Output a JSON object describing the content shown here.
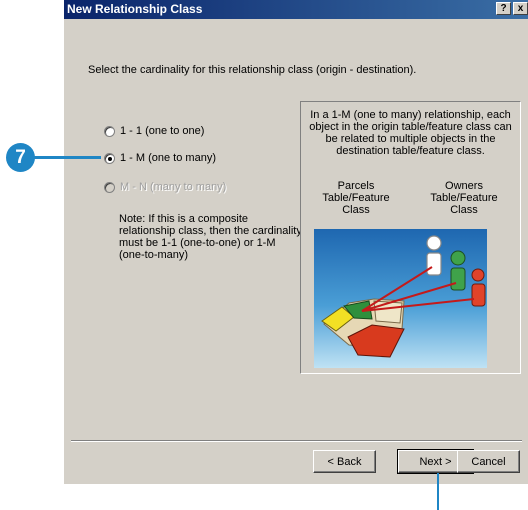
{
  "window": {
    "title": "New Relationship Class",
    "help_glyph": "?",
    "close_glyph": "x"
  },
  "prompt": "Select the cardinality for this relationship class (origin - destination).",
  "options": [
    {
      "label": "1 - 1 (one to one)",
      "checked": false,
      "enabled": true
    },
    {
      "label": "1 - M (one to many)",
      "checked": true,
      "enabled": true
    },
    {
      "label": "M - N (many to many)",
      "checked": false,
      "enabled": false
    }
  ],
  "note": "Note: If this is a composite relationship class, then the cardinality must be 1-1 (one-to-one) or 1-M (one-to-many)",
  "panel": {
    "description": "In a 1-M (one to many) relationship, each object in the origin table/feature class can be related to multiple objects in the destination table/feature class.",
    "origin_label": "Parcels Table/Feature Class",
    "destination_label": "Owners Table/Feature Class"
  },
  "buttons": {
    "back": "< Back",
    "next": "Next >",
    "cancel": "Cancel"
  },
  "callout": {
    "step": "7"
  }
}
